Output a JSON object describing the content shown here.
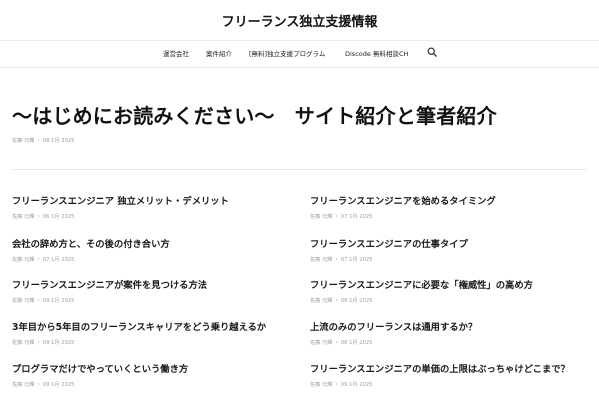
{
  "site": {
    "title": "フリーランス独立支援情報"
  },
  "nav": {
    "items": [
      "運営会社",
      "案件紹介",
      "[無料]独立支援プログラム",
      "Discode 無料相談CH"
    ]
  },
  "page": {
    "title": "〜はじめにお読みください〜　サイト紹介と筆者紹介",
    "meta": "佐藤 元輝 ・ 08 1月 2025"
  },
  "posts_left": [
    {
      "title": "フリーランスエンジニア 独立メリット・デメリット",
      "meta": "佐藤 元輝 ・ 06 1月 2025"
    },
    {
      "title": "会社の辞め方と、その後の付き合い方",
      "meta": "佐藤 元輝 ・ 07 1月 2025"
    },
    {
      "title": "フリーランスエンジニアが案件を見つける方法",
      "meta": "佐藤 元輝 ・ 09 1月 2025"
    },
    {
      "title": "3年目から5年目のフリーランスキャリアをどう乗り越えるか",
      "meta": "佐藤 元輝 ・ 09 1月 2025"
    },
    {
      "title": "プログラマだけでやっていくという働き方",
      "meta": "佐藤 元輝 ・ 09 1月 2025"
    }
  ],
  "posts_right": [
    {
      "title": "フリーランスエンジニアを始めるタイミング",
      "meta": "佐藤 元輝 ・ 07 1月 2025"
    },
    {
      "title": "フリーランスエンジニアの仕事タイプ",
      "meta": "佐藤 元輝 ・ 07 1月 2025"
    },
    {
      "title": "フリーランスエンジニアに必要な「権威性」の高め方",
      "meta": "佐藤 元輝 ・ 08 1月 2025"
    },
    {
      "title": "上流のみのフリーランスは通用するか？",
      "meta": "佐藤 元輝 ・ 08 1月 2025"
    },
    {
      "title": "フリーランスエンジニアの単価の上限はぶっちゃけどこまで？",
      "meta": "佐藤 元輝 ・ 09 1月 2025"
    }
  ]
}
